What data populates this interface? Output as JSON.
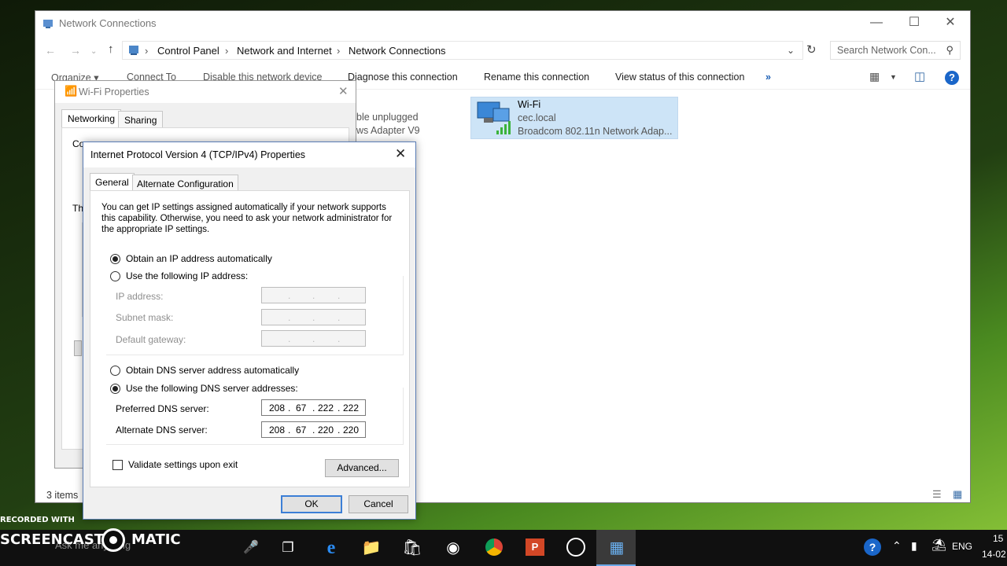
{
  "explorer": {
    "title": "Network Connections",
    "breadcrumb": [
      "Control Panel",
      "Network and Internet",
      "Network Connections"
    ],
    "search_placeholder": "Search Network Con...",
    "commands": [
      "Organize ▾",
      "Connect To",
      "Disable this network device",
      "Diagnose this connection",
      "Rename this connection",
      "View status of this connection",
      "»"
    ],
    "bg_item_line1": "ble unplugged",
    "bg_item_line2": "ws Adapter V9",
    "wifi_tile": {
      "name": "Wi-Fi",
      "domain": "cec.local",
      "adapter": "Broadcom 802.11n Network Adap..."
    },
    "status_items": "3 items"
  },
  "wifi_props": {
    "title": "Wi-Fi Properties",
    "tabs": [
      "Networking",
      "Sharing"
    ],
    "partial_connect": "Co",
    "partial_this": "Th"
  },
  "ipv4": {
    "title": "Internet Protocol Version 4 (TCP/IPv4) Properties",
    "tabs": [
      "General",
      "Alternate Configuration"
    ],
    "description": "You can get IP settings assigned automatically if your network supports this capability. Otherwise, you need to ask your network administrator for the appropriate IP settings.",
    "obtain_ip_auto": "Obtain an IP address automatically",
    "use_following_ip": "Use the following IP address:",
    "ip_address_label": "IP address:",
    "subnet_label": "Subnet mask:",
    "gateway_label": "Default gateway:",
    "obtain_dns_auto": "Obtain DNS server address automatically",
    "use_following_dns": "Use the following DNS server addresses:",
    "preferred_dns_label": "Preferred DNS server:",
    "preferred_dns": [
      "208",
      "67",
      "222",
      "222"
    ],
    "alternate_dns_label": "Alternate DNS server:",
    "alternate_dns": [
      "208",
      "67",
      "220",
      "220"
    ],
    "validate_label": "Validate settings upon exit",
    "advanced_label": "Advanced...",
    "ok_label": "OK",
    "cancel_label": "Cancel"
  },
  "taskbar": {
    "recorded_with": "RECORDED WITH",
    "screencast": "SCREENCAST",
    "matic": "MATIC",
    "ask": "Ask me anything",
    "lang": "ENG",
    "time": "15",
    "date": "14-02"
  }
}
